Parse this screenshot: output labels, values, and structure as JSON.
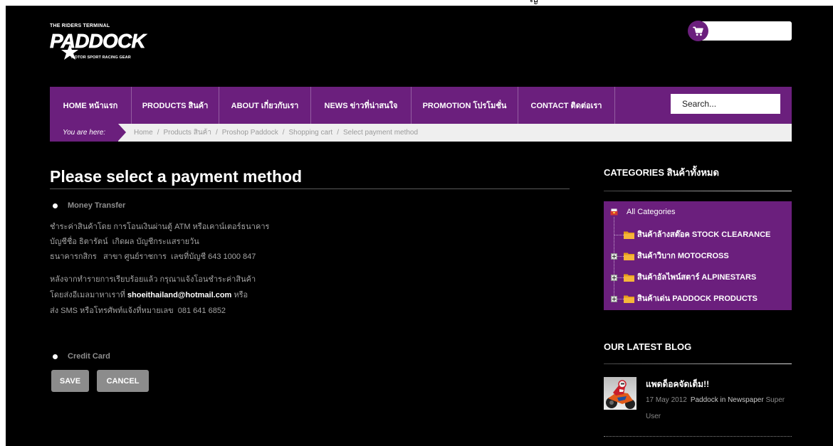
{
  "top_strip": {
    "glyph": "ญ"
  },
  "theme": {
    "accent": "#6b1f7d",
    "background": "#000000",
    "breadcrumb_bar": "#efefef",
    "button": "#8c8c8c",
    "muted_text": "#a3a3a3"
  },
  "logo": {
    "tagline_top": "THE RIDERS TERMINAL",
    "wordmark": "PADDOCK",
    "tagline_bottom": "MOTOR SPORT RACING GEAR",
    "icon": "star-icon"
  },
  "cart": {
    "icon": "cart-icon"
  },
  "nav": {
    "items": [
      {
        "label": "HOME หน้าแรก"
      },
      {
        "label": "PRODUCTS สินค้า"
      },
      {
        "label": "ABOUT เกี่ยวกับเรา"
      },
      {
        "label": "NEWS ข่าวที่น่าสนใจ"
      },
      {
        "label": "PROMOTION โปรโมชั่น"
      },
      {
        "label": "CONTACT ติดต่อเรา"
      }
    ],
    "search_placeholder": "Search..."
  },
  "breadcrumb": {
    "prefix": "You are here:",
    "separator": "/",
    "items": [
      "Home",
      "Products สินค้า",
      "Proshop Paddock",
      "Shopping cart",
      "Select payment method"
    ]
  },
  "payment": {
    "title": "Please select a payment method",
    "methods": [
      {
        "label": "Money Transfer"
      },
      {
        "label": "Credit Card"
      }
    ],
    "money_transfer": {
      "account_lines": [
        "ชำระค่าสินค้าโดย การโอนเงินผ่านตู้ ATM หรือเคาน์เตอร์ธนาคาร",
        "บัญชีชื่อ ธิตารัตน์  เกิดผล บัญชีกระแสรายวัน",
        "ธนาคารกสิกร   สาขา ศูนย์ราชการ  เลขที่บัญชี 643 1000 847"
      ],
      "notify_line1": "หลังจากทำรายการเรียบร้อยแล้ว กรุณาแจ้งโอนชำระค่าสินค้า",
      "notify_line2_before": "โดยส่งอีเมลมาหาเราที่",
      "email": "shoeithailand@hotmail.com",
      "notify_line2_after": "หรือ",
      "notify_line3": "ส่ง SMS หรือโทรศัพท์แจ้งที่หมายเลข  081 641 6852"
    },
    "save_label": "SAVE",
    "cancel_label": "CANCEL"
  },
  "sidebar": {
    "categories": {
      "title": "CATEGORIES สินค้าทั้งหมด",
      "root_label": "All Categories",
      "root_icon": "category-root-icon",
      "item_icon": "folder-icon",
      "expand_icon": "expand-icon",
      "items": [
        {
          "label": "สินค้าล้างสต๊อค STOCK CLEARANCE",
          "expandable": false
        },
        {
          "label": "สินค้าวิบาก MOTOCROSS",
          "expandable": true
        },
        {
          "label": "สินค้าอัลไพน์สตาร์ ALPINESTARS",
          "expandable": true
        },
        {
          "label": "สินค้าเด่น PADDOCK PRODUCTS",
          "expandable": true
        }
      ]
    },
    "blog": {
      "title": "OUR LATEST BLOG",
      "posts": [
        {
          "title": "แพดด็อคจัดเต็ม!!",
          "date": "17 May 2012",
          "category": "Paddock in Newspaper",
          "author": "Super User"
        }
      ]
    }
  }
}
